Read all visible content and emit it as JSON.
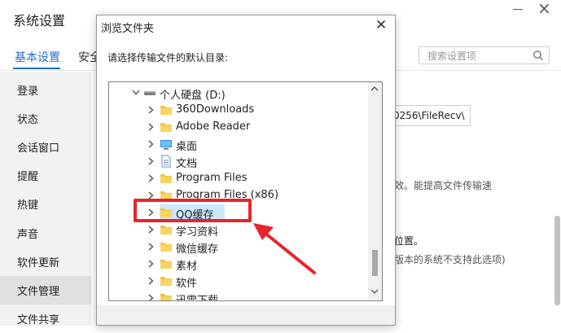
{
  "window": {
    "title": "系统设置"
  },
  "tabs": [
    {
      "label": "基本设置",
      "active": true
    },
    {
      "label": "安全"
    }
  ],
  "search": {
    "placeholder": "搜索设置项"
  },
  "sidebar": {
    "items": [
      {
        "label": "登录"
      },
      {
        "label": "状态"
      },
      {
        "label": "会话窗口"
      },
      {
        "label": "提醒"
      },
      {
        "label": "热键"
      },
      {
        "label": "声音"
      },
      {
        "label": "软件更新"
      },
      {
        "label": "文件管理",
        "active": true
      },
      {
        "label": "文件共享"
      }
    ]
  },
  "background": {
    "path_value": "0256\\FileRecv\\",
    "speed_text": "效。能提高文件传输速",
    "position_text": "位置。",
    "old_system_text": "版本的系统不支持此选项)"
  },
  "dialog": {
    "title": "浏览文件夹",
    "prompt": "请选择传输文件的默认目录:",
    "tree": [
      {
        "label": "个人硬盘 (D:)",
        "icon": "drive-icon",
        "expanded": true,
        "level": 0
      },
      {
        "label": "360Downloads",
        "icon": "folder-icon",
        "level": 1
      },
      {
        "label": "Adobe Reader",
        "icon": "folder-icon",
        "level": 1
      },
      {
        "label": "桌面",
        "icon": "desktop-icon",
        "level": 1
      },
      {
        "label": "文档",
        "icon": "document-icon",
        "level": 1
      },
      {
        "label": "Program Files",
        "icon": "folder-icon",
        "level": 1
      },
      {
        "label": "Program Files (x86)",
        "icon": "folder-icon",
        "level": 1
      },
      {
        "label": "QQ缓存",
        "icon": "folder-icon",
        "level": 1,
        "selected": true
      },
      {
        "label": "学习资料",
        "icon": "folder-icon",
        "level": 1
      },
      {
        "label": "微信缓存",
        "icon": "folder-icon",
        "level": 1
      },
      {
        "label": "素材",
        "icon": "folder-icon",
        "level": 1
      },
      {
        "label": "软件",
        "icon": "folder-icon",
        "level": 1
      },
      {
        "label": "迅雷下载",
        "icon": "folder-icon",
        "level": 1
      }
    ]
  },
  "colors": {
    "accent": "#1f6fd0",
    "annotation_red": "#e8242d",
    "folder_yellow": "#f3c33c",
    "selection_blue": "#cce8ff"
  }
}
